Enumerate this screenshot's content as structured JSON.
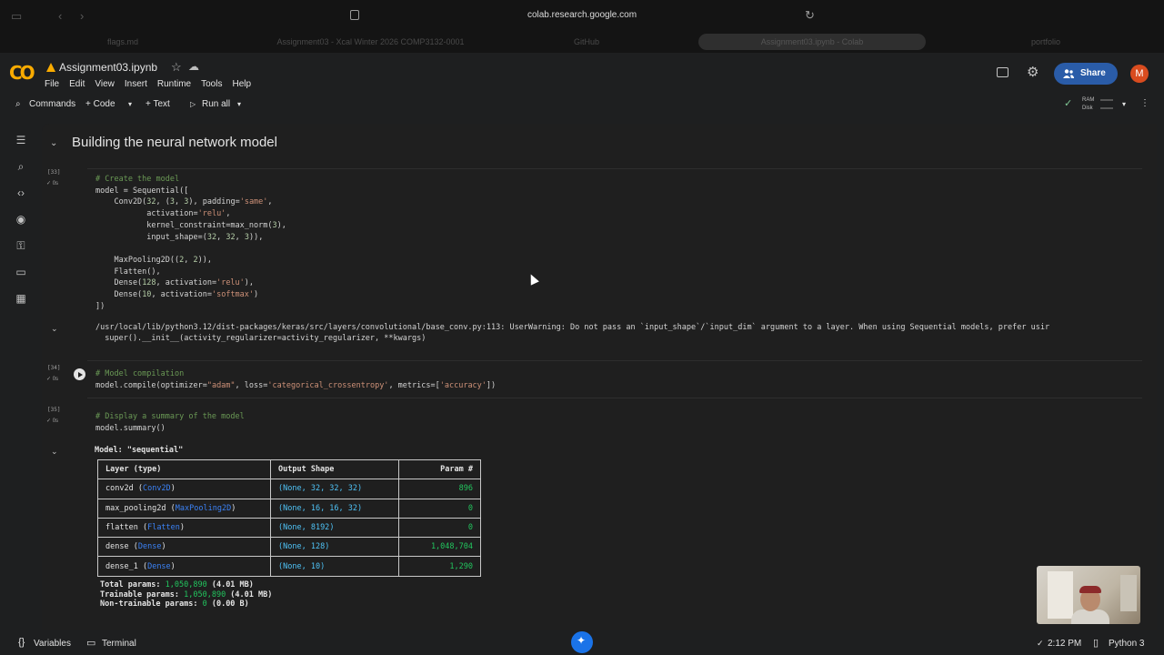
{
  "browser": {
    "url": "colab.research.google.com",
    "tabs": [
      "flags.md",
      "Assignment03 - Xcal Winter 2026 COMP3132-0001",
      "GitHub",
      "Assignment03.ipynb - Colab",
      "portfolio"
    ]
  },
  "header": {
    "title": "Assignment03.ipynb",
    "menu": [
      "File",
      "Edit",
      "View",
      "Insert",
      "Runtime",
      "Tools",
      "Help"
    ],
    "share_label": "Share",
    "avatar_letter": "M"
  },
  "toolbar": {
    "commands_label": "Commands",
    "code_label": "+ Code",
    "text_label": "+ Text",
    "run_all_label": "Run all",
    "ram_label": "RAM",
    "disk_label": "Disk"
  },
  "section": {
    "title": "Building the neural network model"
  },
  "cells": [
    {
      "count": "[33]",
      "time": "0s"
    },
    {
      "count": "[34]",
      "time": "0s"
    },
    {
      "count": "[35]",
      "time": "0s"
    }
  ],
  "warning": {
    "line1": "/usr/local/lib/python3.12/dist-packages/keras/src/layers/convolutional/base_conv.py:113: UserWarning: Do not pass an `input_shape`/`input_dim` argument to a layer. When using Sequential models, prefer usir",
    "line2": "  super().__init__(activity_regularizer=activity_regularizer, **kwargs)"
  },
  "summary": {
    "model_label": "Model: \"sequential\"",
    "headers": [
      "Layer (type)",
      "Output Shape",
      "Param #"
    ],
    "rows": [
      {
        "name": "conv2d",
        "type": "Conv2D",
        "shape_prefix": "(None, ",
        "shape_dims": "32, 32, 32",
        "params": "896"
      },
      {
        "name": "max_pooling2d",
        "type": "MaxPooling2D",
        "shape_prefix": "(None, ",
        "shape_dims": "16, 16, 32",
        "params": "0"
      },
      {
        "name": "flatten",
        "type": "Flatten",
        "shape_prefix": "(None, ",
        "shape_dims": "8192",
        "params": "0"
      },
      {
        "name": "dense",
        "type": "Dense",
        "shape_prefix": "(None, ",
        "shape_dims": "128",
        "params": "1,048,704"
      },
      {
        "name": "dense_1",
        "type": "Dense",
        "shape_prefix": "(None, ",
        "shape_dims": "10",
        "params": "1,290"
      }
    ],
    "total_label": "Total params: ",
    "total_value": "1,050,890",
    "total_size": " (4.01 MB)",
    "trainable_label": "Trainable params: ",
    "trainable_value": "1,050,890",
    "trainable_size": " (4.01 MB)",
    "nontrainable_label": "Non-trainable params: ",
    "nontrainable_value": "0",
    "nontrainable_size": " (0.00 B)"
  },
  "statusbar": {
    "variables_label": "Variables",
    "terminal_label": "Terminal",
    "time": "2:12 PM",
    "kernel": "Python 3"
  }
}
